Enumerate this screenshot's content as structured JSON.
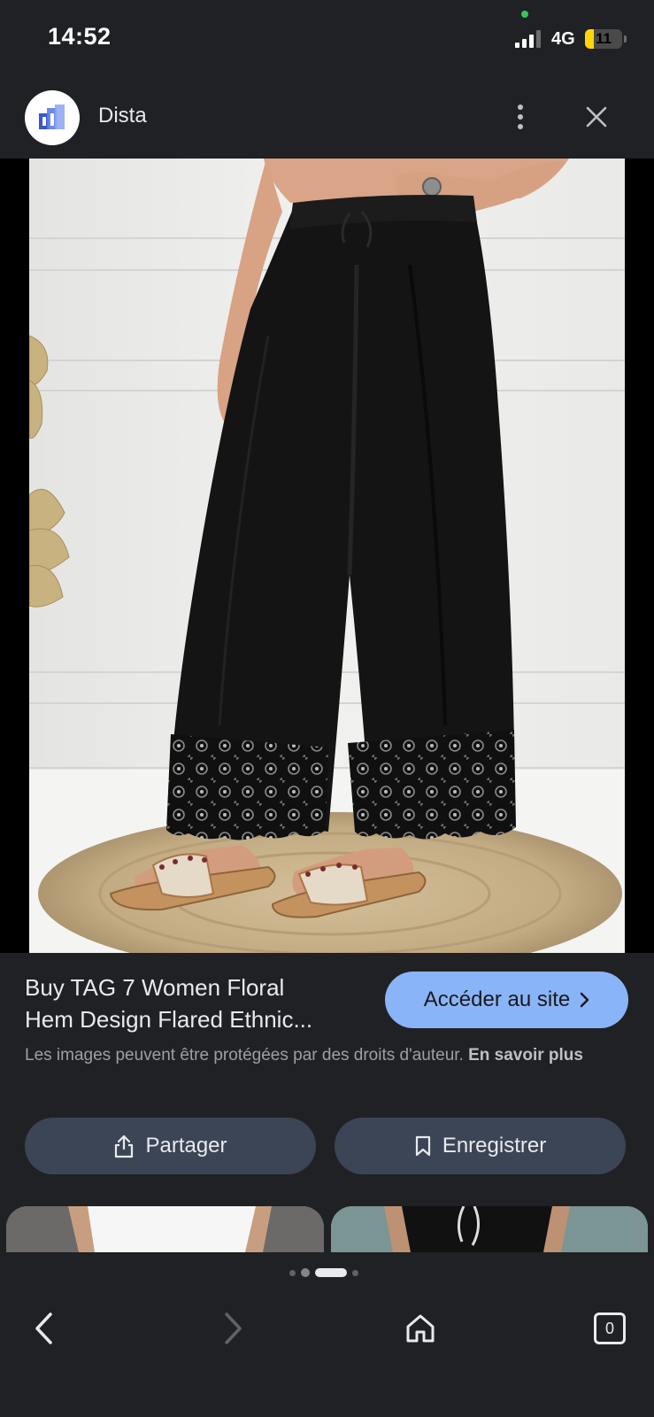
{
  "status_bar": {
    "time": "14:52",
    "network": "4G",
    "battery_level": "11",
    "signal_bars": 3,
    "signal_bars_total": 4
  },
  "header": {
    "site_name": "Dista",
    "logo_icon": "dista-logo-icon",
    "more_icon": "more-vert-icon",
    "close_icon": "close-icon"
  },
  "result": {
    "title_line1": "Buy TAG 7 Women Floral",
    "title_line2": "Hem Design Flared Ethnic...",
    "visit_label": "Accéder au site",
    "copyright_text": "Les images peuvent être protégées par des droits d'auteur.",
    "learn_more": "En savoir plus"
  },
  "actions": {
    "share_label": "Partager",
    "save_label": "Enregistrer"
  },
  "pager": {
    "page_count": 4,
    "active_index": 2
  },
  "browser_nav": {
    "tabs_count": "0"
  },
  "colors": {
    "background": "#202124",
    "accent_button": "#8ab4f8",
    "secondary_button": "#3c4556",
    "text_primary": "#e8eaed",
    "text_secondary": "#9aa0a6"
  }
}
